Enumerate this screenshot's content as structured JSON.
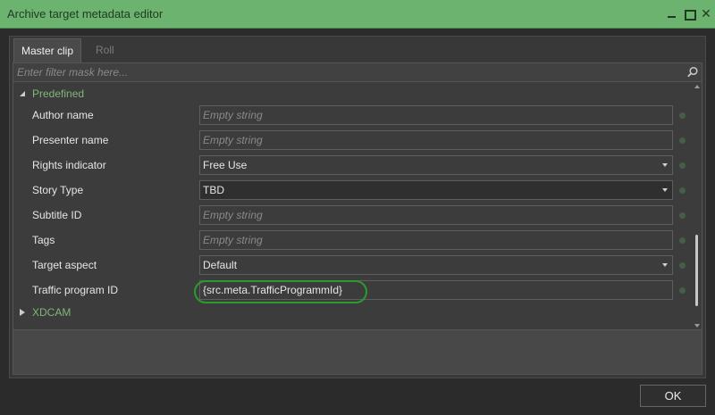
{
  "window": {
    "title": "Archive target metadata editor",
    "accent_color": "#6cb36f"
  },
  "tabs": [
    {
      "label": "Master clip",
      "active": true
    },
    {
      "label": "Roll",
      "active": false
    }
  ],
  "filter": {
    "placeholder": "Enter filter mask here..."
  },
  "groups": {
    "predefined": {
      "label": "Predefined",
      "expanded": true
    },
    "xdcam": {
      "label": "XDCAM",
      "expanded": false
    }
  },
  "rows": [
    {
      "label": "Author name",
      "value": "Empty string",
      "empty": true,
      "combo": false
    },
    {
      "label": "Presenter name",
      "value": "Empty string",
      "empty": true,
      "combo": false
    },
    {
      "label": "Rights indicator",
      "value": "Free Use",
      "empty": false,
      "combo": true
    },
    {
      "label": "Story Type",
      "value": "TBD",
      "empty": false,
      "combo": true
    },
    {
      "label": "Subtitle ID",
      "value": "Empty string",
      "empty": true,
      "combo": false
    },
    {
      "label": "Tags",
      "value": "Empty string",
      "empty": true,
      "combo": false
    },
    {
      "label": "Target aspect",
      "value": "Default",
      "empty": false,
      "combo": true
    },
    {
      "label": "Traffic program ID",
      "value": "{src.meta.TrafficProgrammId}",
      "empty": false,
      "combo": false,
      "highlighted": true
    }
  ],
  "footer": {
    "ok_label": "OK"
  },
  "icons": {
    "search": "search-icon",
    "minimize": "minimize-icon",
    "maximize": "maximize-icon",
    "close": "close-icon"
  }
}
